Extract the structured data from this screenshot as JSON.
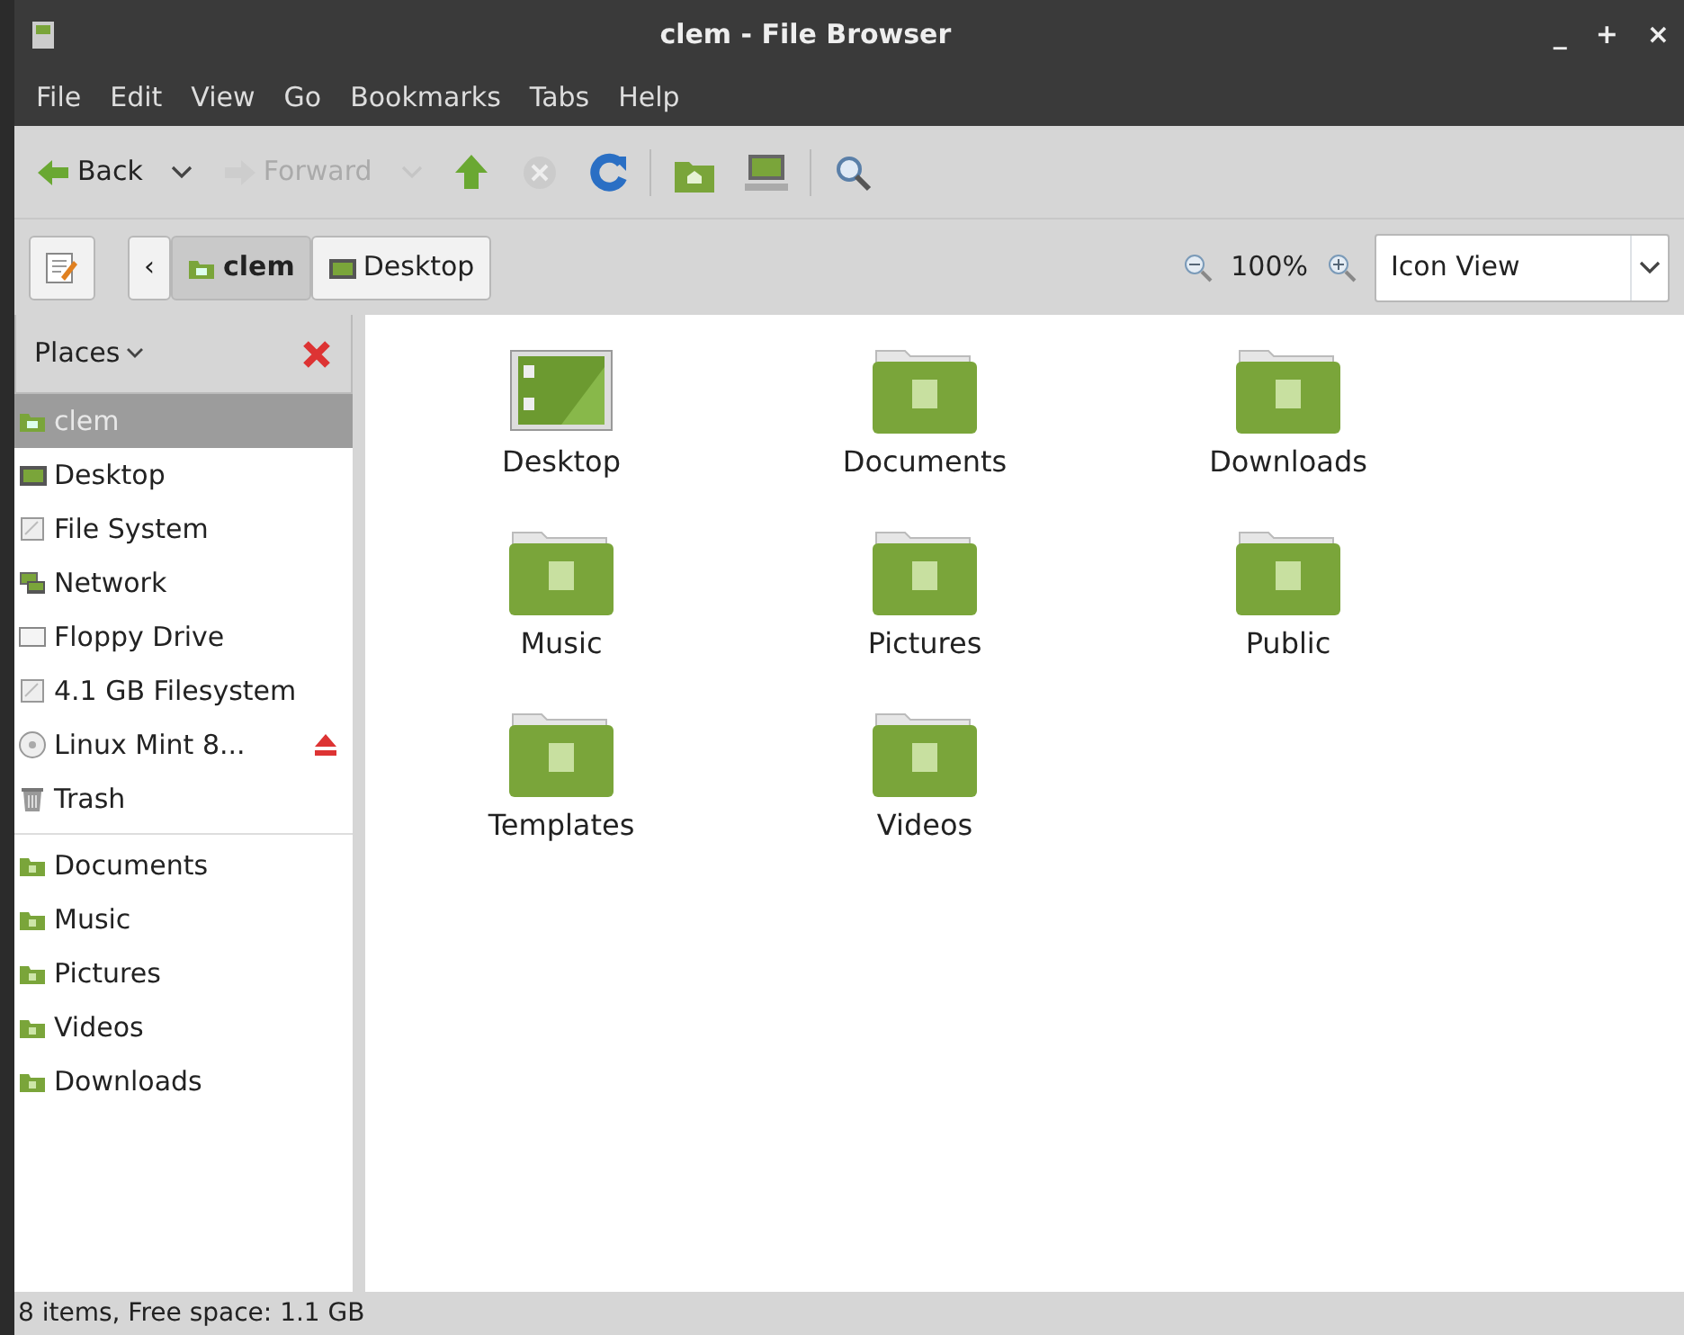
{
  "window": {
    "title": "clem - File Browser",
    "controls": [
      "_",
      "+",
      "×"
    ]
  },
  "menu": [
    "File",
    "Edit",
    "View",
    "Go",
    "Bookmarks",
    "Tabs",
    "Help"
  ],
  "toolbar": [
    {
      "kind": "back",
      "label": "Back",
      "disabled": false,
      "dropdown": true
    },
    {
      "kind": "forward",
      "label": "Forward",
      "disabled": true,
      "dropdown": true
    },
    {
      "kind": "separator-less-up",
      "disabled": false
    },
    {
      "kind": "stop",
      "disabled": true
    },
    {
      "kind": "reload",
      "disabled": false
    },
    {
      "kind": "sep"
    },
    {
      "kind": "home",
      "disabled": false
    },
    {
      "kind": "computer",
      "disabled": false
    },
    {
      "kind": "sep"
    },
    {
      "kind": "search",
      "disabled": false
    }
  ],
  "location": {
    "back_glyph": "‹",
    "path": [
      {
        "label": "clem",
        "kind": "home",
        "selected": true
      },
      {
        "label": "Desktop",
        "kind": "desktop",
        "selected": false
      }
    ],
    "zoom": "100%",
    "view": "Icon View"
  },
  "sidebar": {
    "title": "Places",
    "devices": [
      {
        "label": "clem",
        "kind": "home",
        "selected": true
      },
      {
        "label": "Desktop",
        "kind": "desktop",
        "selected": false
      },
      {
        "label": "File System",
        "kind": "drive",
        "selected": false
      },
      {
        "label": "Network",
        "kind": "network",
        "selected": false
      },
      {
        "label": "Floppy Drive",
        "kind": "floppy",
        "selected": false
      },
      {
        "label": "4.1 GB Filesystem",
        "kind": "drive",
        "selected": false
      },
      {
        "label": "Linux Mint 8...",
        "kind": "disc",
        "selected": false,
        "ejectable": true
      },
      {
        "label": "Trash",
        "kind": "trash",
        "selected": false
      }
    ],
    "bookmarks": [
      {
        "label": "Documents",
        "kind": "folder",
        "selected": false
      },
      {
        "label": "Music",
        "kind": "folder",
        "selected": false
      },
      {
        "label": "Pictures",
        "kind": "folder",
        "selected": false
      },
      {
        "label": "Videos",
        "kind": "folder",
        "selected": false
      },
      {
        "label": "Downloads",
        "kind": "folder",
        "selected": false
      }
    ]
  },
  "files": [
    {
      "name": "Desktop",
      "kind": "desktop"
    },
    {
      "name": "Documents",
      "kind": "folder"
    },
    {
      "name": "Downloads",
      "kind": "folder"
    },
    {
      "name": "Music",
      "kind": "folder"
    },
    {
      "name": "Pictures",
      "kind": "folder"
    },
    {
      "name": "Public",
      "kind": "folder"
    },
    {
      "name": "Templates",
      "kind": "folder"
    },
    {
      "name": "Videos",
      "kind": "folder"
    }
  ],
  "status_bar": "8 items, Free space: 1.1 GB"
}
